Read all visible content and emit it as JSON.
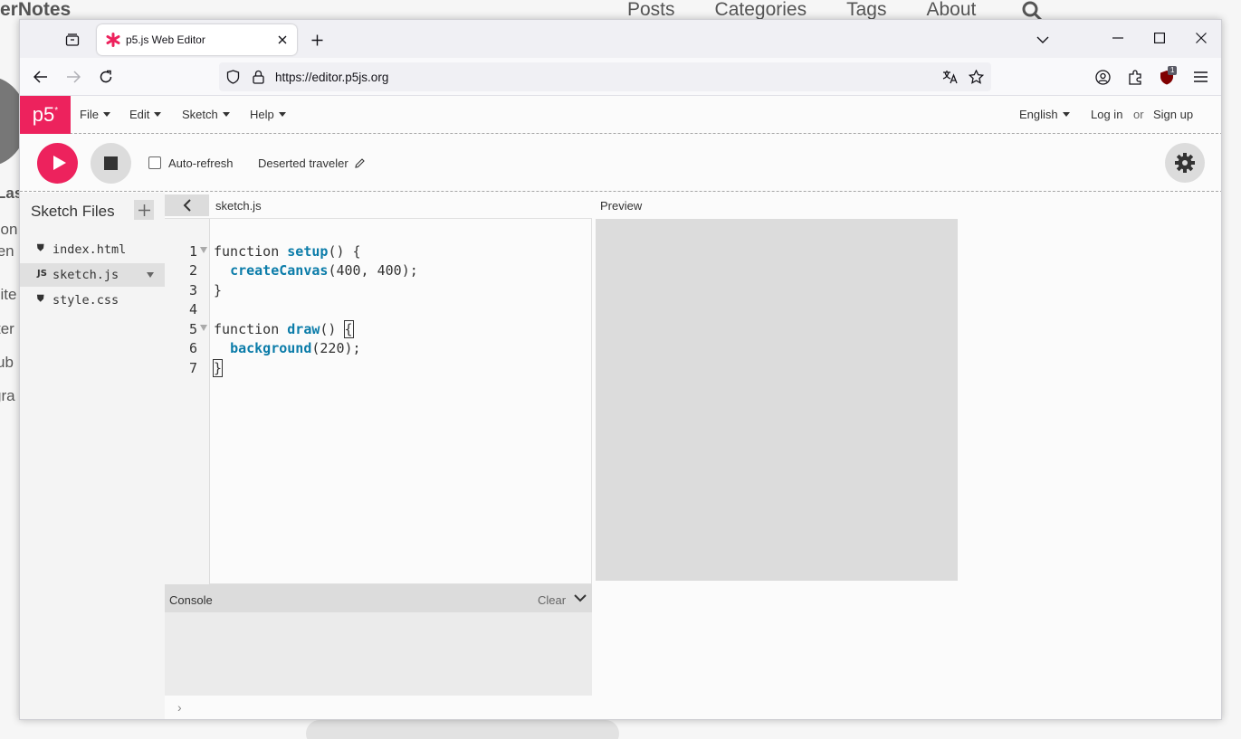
{
  "background_site": {
    "brand": "erNotes",
    "nav": [
      "Posts",
      "Categories",
      "Tags",
      "About"
    ],
    "side_fragments": [
      "Las",
      "son",
      "ten",
      "site",
      "ter",
      "ub",
      "gra"
    ]
  },
  "browser": {
    "tab": {
      "title": "p5.js Web Editor"
    },
    "url": "https://editor.p5js.org",
    "extension_badge": "1",
    "icons": [
      "tab-overview-icon",
      "close-icon",
      "plus-icon",
      "chevron-down-icon",
      "minimize-icon",
      "maximize-icon",
      "close-window-icon",
      "back-arrow-icon",
      "forward-arrow-icon",
      "reload-icon",
      "shield-icon",
      "lock-icon",
      "translate-icon",
      "star-icon",
      "account-icon",
      "extensions-icon",
      "ublock-icon",
      "hamburger-menu-icon"
    ]
  },
  "p5": {
    "logo": "p5",
    "logo_sup": "*",
    "menu": {
      "file": "File",
      "edit": "Edit",
      "sketch": "Sketch",
      "help": "Help"
    },
    "language": "English",
    "login": "Log in",
    "or": "or",
    "signup": "Sign up",
    "toolbar": {
      "auto_refresh": "Auto-refresh",
      "sketch_name": "Deserted traveler"
    },
    "sidebar": {
      "title": "Sketch Files",
      "files": [
        {
          "icon": "⛊",
          "name": "index.html"
        },
        {
          "icon": "JS",
          "name": "sketch.js"
        },
        {
          "icon": "⛊",
          "name": "style.css"
        }
      ]
    },
    "editor": {
      "file_name": "sketch.js",
      "line_numbers": [
        "1",
        "2",
        "3",
        "4",
        "5",
        "6",
        "7"
      ],
      "lines": [
        {
          "pre": "function ",
          "fn": "setup",
          "post": "() {",
          "fn_class": ""
        },
        {
          "pre": "  ",
          "fn": "createCanvas",
          "post": "(400, 400);"
        },
        {
          "pre": "}",
          "fn": "",
          "post": ""
        },
        {
          "pre": "",
          "fn": "",
          "post": ""
        },
        {
          "pre": "function ",
          "fn": "draw",
          "post": "() {"
        },
        {
          "pre": "  ",
          "fn": "background",
          "post": "(220);"
        },
        {
          "pre": "}",
          "fn": "",
          "post": ""
        }
      ]
    },
    "console": {
      "title": "Console",
      "clear": "Clear",
      "prompt": "›"
    },
    "preview": {
      "label": "Preview"
    },
    "colors": {
      "accent": "#ed225d",
      "function": "#0b7ca9",
      "canvas": "#dcdcdc"
    }
  }
}
